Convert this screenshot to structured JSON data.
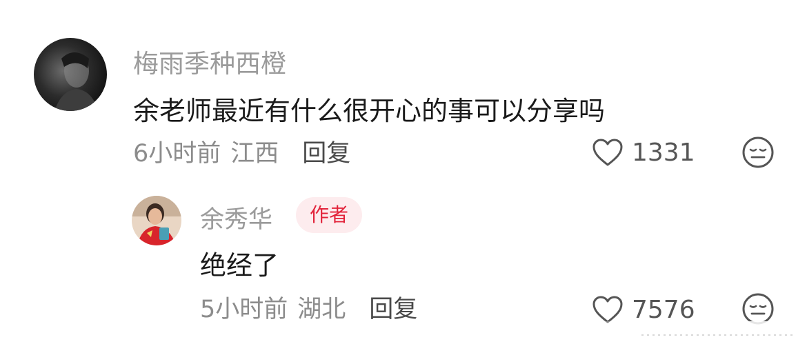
{
  "comments": [
    {
      "username": "梅雨季种西橙",
      "text": "余老师最近有什么很开心的事可以分享吗",
      "time": "6小时前",
      "location": "江西",
      "reply_label": "回复",
      "likes": "1331"
    },
    {
      "username": "余秀华",
      "badge": "作者",
      "text": "绝经了",
      "time": "5小时前",
      "location": "湖北",
      "reply_label": "回复",
      "likes": "7576"
    }
  ],
  "colors": {
    "username": "#9b9b9b",
    "text": "#1a1a1a",
    "meta": "#8c8c8c",
    "badge_bg": "#fdecee",
    "badge_text": "#e2233a"
  },
  "icons": {
    "like": "heart-outline-icon",
    "reaction": "neutral-face-icon"
  }
}
